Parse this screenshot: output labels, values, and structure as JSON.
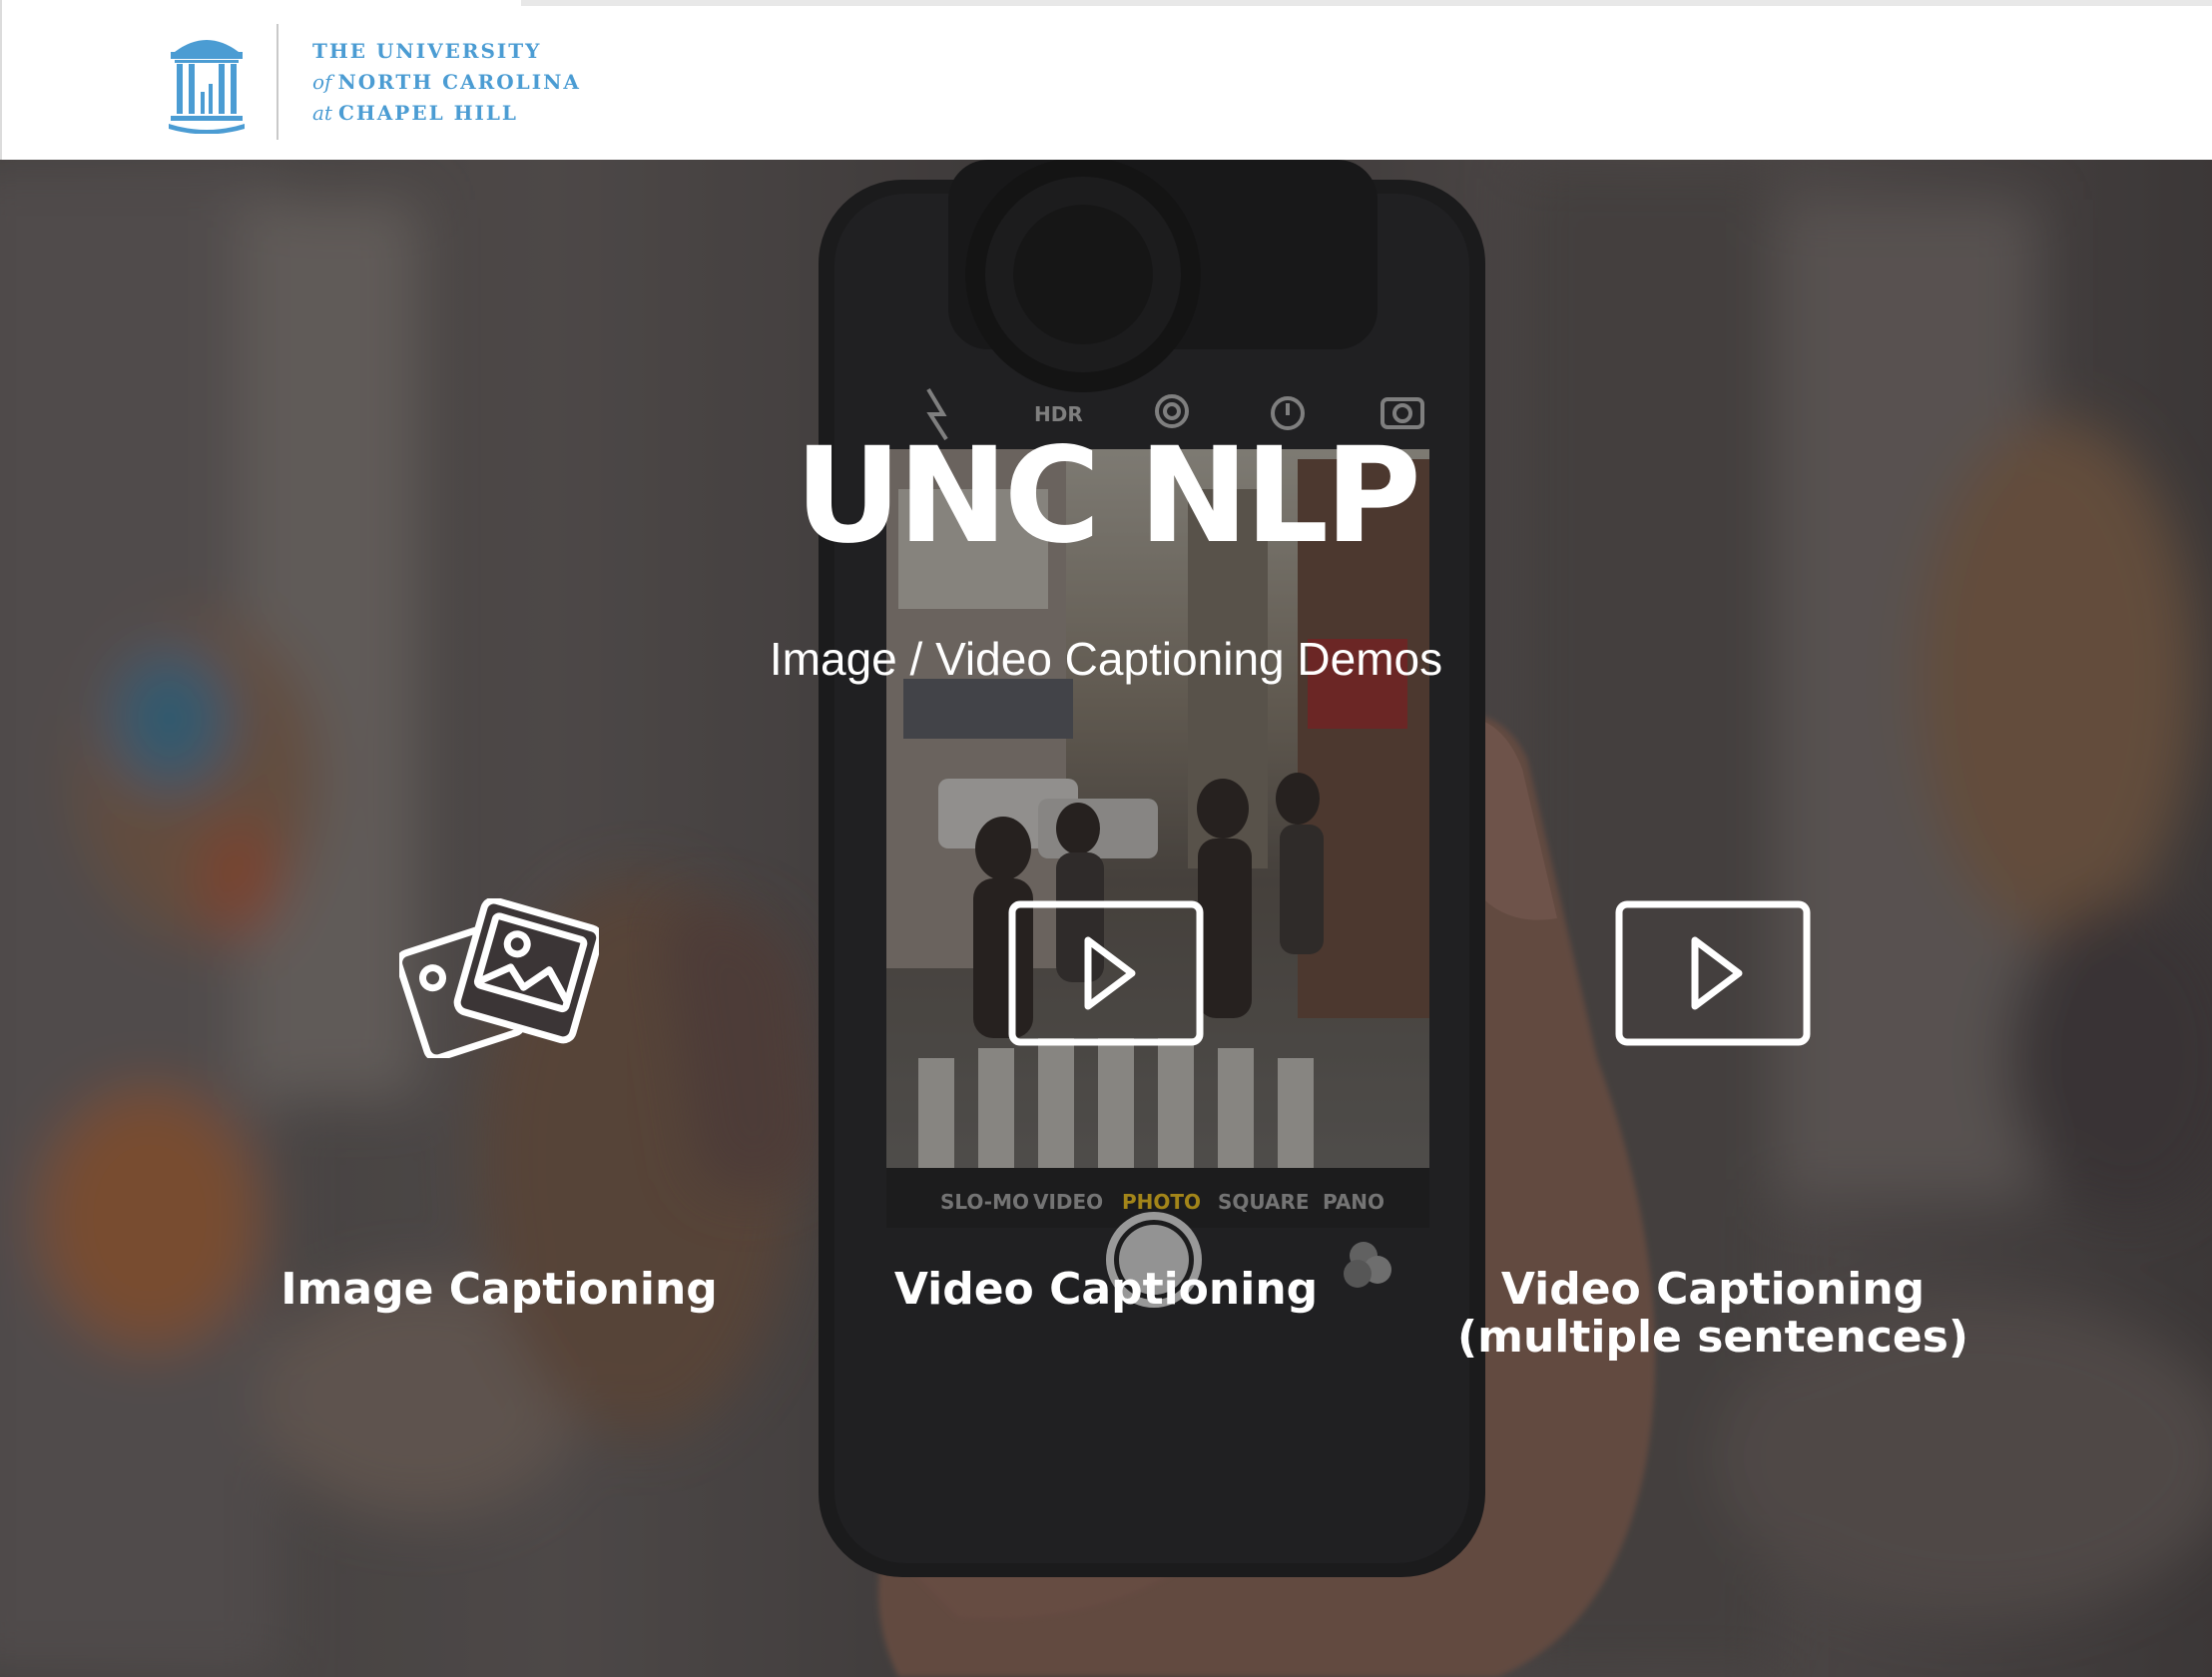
{
  "header": {
    "logo": {
      "line1": "THE UNIVERSITY",
      "line2_prefix": "of",
      "line2": "NORTH CAROLINA",
      "line3_prefix": "at",
      "line3": "CHAPEL HILL",
      "seal_icon": "old-well-icon",
      "color": "#4b9cd3"
    }
  },
  "hero": {
    "title": "UNC NLP",
    "subtitle": "Image / Video Captioning Demos",
    "background": "phone-camera-photo",
    "phone_modes": [
      "SLO-MO",
      "VIDEO",
      "PHOTO",
      "SQUARE",
      "PANO"
    ],
    "phone_active_mode": "PHOTO",
    "phone_top_icons": [
      "flash-off-icon",
      "hdr-icon",
      "live-photo-icon",
      "timer-icon",
      "camera-switch-icon"
    ]
  },
  "demos": [
    {
      "label": "Image Captioning",
      "icon": "images-icon"
    },
    {
      "label": "Video Captioning",
      "icon": "video-play-icon"
    },
    {
      "label": "Video Captioning\n(multiple sentences)",
      "icon": "video-play-icon"
    }
  ],
  "colors": {
    "overlay": "#1e1c1e",
    "text": "#ffffff",
    "accent_mode": "#f5c518"
  }
}
